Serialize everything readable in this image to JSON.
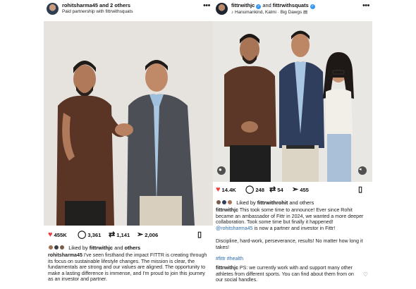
{
  "post1": {
    "username": "rohitsharma45",
    "coauthors": " and 2 others",
    "subtitle": "Paid partnership with fittrwithsquats",
    "likes": "455K",
    "comments": "3,361",
    "reposts": "1,141",
    "shares": "2,006",
    "liked_by_prefix": "Liked by ",
    "liked_by_user": "fittrwithjc",
    "liked_by_suffix": " and ",
    "liked_by_others": "others",
    "caption_user": "rohitsharma45",
    "caption_text": " I've seen firsthand the impact FITTR is creating through its focus on sustainable lifestyle changes. The mission is clear, the fundamentals are strong and our values are aligned. The opportunity to make a lasting difference is immense, and I'm proud to join this journey as an investor and partner."
  },
  "post2": {
    "username": "fittrwithjc",
    "coauthors_and": " and ",
    "coauthor": "fittrwithsquats",
    "subtitle": "Hanumankind, Kalmi · Big Dawgs",
    "likes": "14.4K",
    "comments": "248",
    "reposts": "54",
    "shares": "455",
    "liked_by_prefix": "Liked by ",
    "liked_by_user": "fittrwithrohit",
    "liked_by_suffix": " and others",
    "caption_user": "fittrwithjc",
    "caption_text_1": " This took some time to announce! Ever since Rohit became an ambassador of Fittr in 2024, we wanted a more deeper collaboration. Took some time but finally it happened!",
    "caption_mention": "@rohitsharma45",
    "caption_text_2": " is now a partner and investor in Fittr!",
    "caption_text_3": "Discipline, hard-work, perseverance, results! No matter how long it takes!",
    "hashtag": "#fittr #health",
    "comment_user": "fittrwithjc",
    "comment_text": " PS: we currently work with and support many other athletes from different sports. You can find about them from on our social handles."
  },
  "icons": {
    "heart": "heart-icon",
    "comment": "comment-icon",
    "repost": "repost-icon",
    "share": "share-icon",
    "bookmark": "bookmark-icon",
    "more": "more-icon"
  },
  "colors": {
    "heart": "#ed3e3e",
    "verified": "#3897f0",
    "link": "#2b6cb0"
  }
}
